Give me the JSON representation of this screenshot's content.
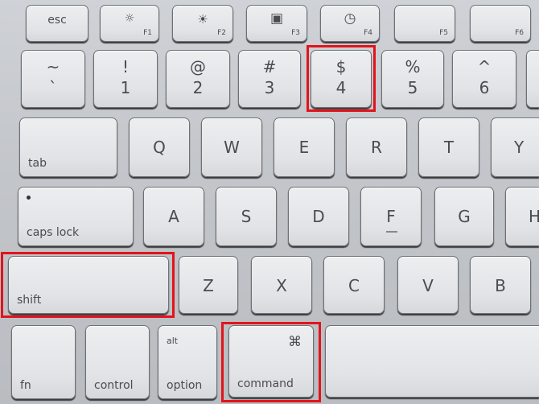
{
  "function_row": [
    {
      "label": "esc"
    },
    {
      "icon": "brightness-down-icon",
      "glyph": "☼",
      "fn": "F1"
    },
    {
      "icon": "brightness-up-icon",
      "glyph": "☀",
      "fn": "F2"
    },
    {
      "icon": "expose-icon",
      "glyph": "▣",
      "fn": "F3"
    },
    {
      "icon": "dashboard-icon",
      "glyph": "◷",
      "fn": "F4"
    },
    {
      "fn": "F5"
    },
    {
      "fn": "F6"
    }
  ],
  "number_row": [
    {
      "top": "~",
      "bottom": "`"
    },
    {
      "top": "!",
      "bottom": "1"
    },
    {
      "top": "@",
      "bottom": "2"
    },
    {
      "top": "#",
      "bottom": "3"
    },
    {
      "top": "$",
      "bottom": "4"
    },
    {
      "top": "%",
      "bottom": "5"
    },
    {
      "top": "^",
      "bottom": "6"
    }
  ],
  "qwerty_row": [
    "tab",
    "Q",
    "W",
    "E",
    "R",
    "T",
    "Y"
  ],
  "home_row": [
    "caps lock",
    "A",
    "S",
    "D",
    "F",
    "G",
    "H"
  ],
  "shift_row": [
    "shift",
    "Z",
    "X",
    "C",
    "V",
    "B"
  ],
  "bottom_row": {
    "fn": "fn",
    "control": "control",
    "option_top": "alt",
    "option": "option",
    "command_symbol": "⌘",
    "command": "command"
  },
  "highlight_color": "#e3131b",
  "highlighted_keys": [
    "4",
    "shift",
    "command"
  ]
}
